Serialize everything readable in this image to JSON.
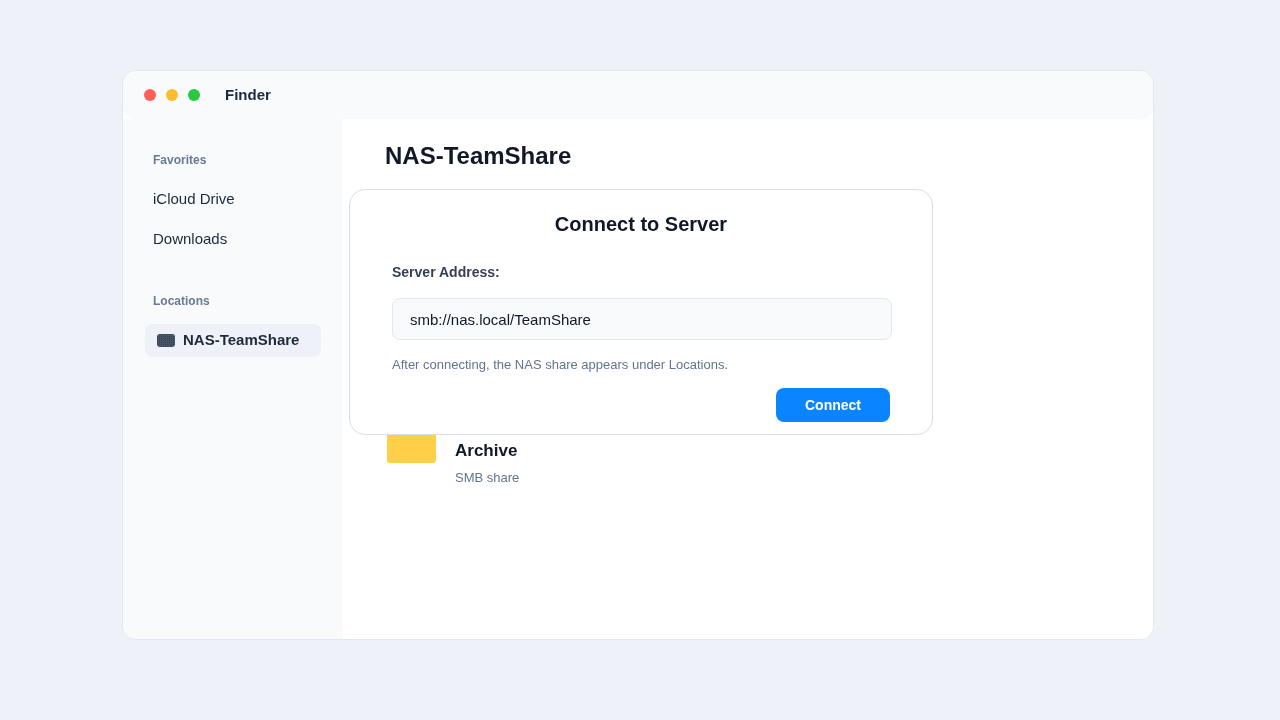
{
  "window": {
    "title": "Finder"
  },
  "sidebar": {
    "sections": [
      {
        "heading": "Favorites",
        "items": [
          {
            "label": "iCloud Drive",
            "kind": "place",
            "selected": false
          },
          {
            "label": "Downloads",
            "kind": "place",
            "selected": false
          }
        ]
      },
      {
        "heading": "Locations",
        "items": [
          {
            "label": "NAS-TeamShare",
            "kind": "volume",
            "selected": true
          }
        ]
      }
    ]
  },
  "main": {
    "title": "NAS-TeamShare",
    "items": [
      {
        "name": "Archive",
        "subtitle": "SMB share"
      }
    ]
  },
  "dialog": {
    "title": "Connect to Server",
    "field": {
      "label": "Server Address:",
      "value": "smb://nas.local/TeamShare"
    },
    "hint": "After connecting, the NAS share appears under Locations.",
    "buttons": [
      "Connect"
    ]
  }
}
